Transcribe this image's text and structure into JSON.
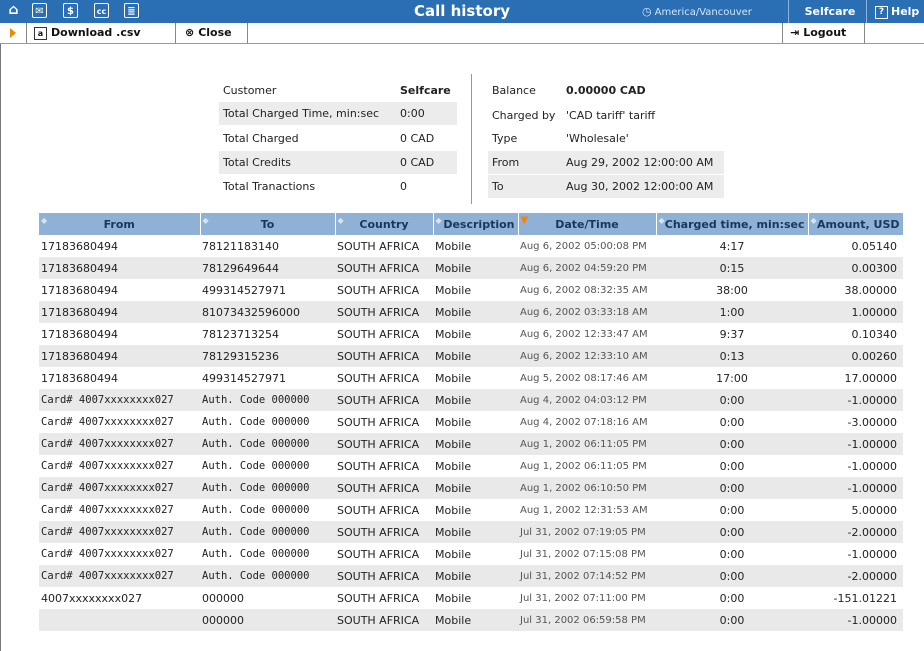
{
  "titlebar": {
    "title": "Call history",
    "timezone": "America/Vancouver",
    "user": "Selfcare",
    "help": "Help",
    "icons": [
      "home-icon",
      "mail-icon",
      "dollar-icon",
      "cc-icon",
      "list-icon"
    ],
    "color": "#2a6eb4"
  },
  "toolbar": {
    "download": "Download .csv",
    "close": "Close",
    "logout": "Logout"
  },
  "summary": {
    "customer_label": "Customer",
    "customer_value": "Selfcare",
    "charged_time_label": "Total Charged Time, min:sec",
    "charged_time_value": "0:00",
    "charged_label": "Total Charged",
    "charged_value": "0 CAD",
    "credits_label": "Total Credits",
    "credits_value": "0 CAD",
    "transactions_label": "Total Tranactions",
    "transactions_value": "0",
    "balance_label": "Balance",
    "balance_value": "0.00000 CAD",
    "charged_by_label": "Charged by",
    "charged_by_value": "'CAD tariff' tariff",
    "type_label": "Type",
    "type_value": "'Wholesale'",
    "from_label": "From",
    "from_value": "Aug 29, 2002 12:00:00 AM",
    "to_label": "To",
    "to_value": "Aug 30, 2002 12:00:00 AM"
  },
  "table": {
    "columns": [
      "From",
      "To",
      "Country",
      "Description",
      "Date/Time",
      "Charged time, min:sec",
      "Amount, USD"
    ],
    "sorted_column": "Date/Time",
    "rows": [
      {
        "from": "17183680494",
        "to": "78121183140",
        "country": "SOUTH AFRICA",
        "desc": "Mobile",
        "date": "Aug 6, 2002 05:00:08 PM",
        "time": "4:17",
        "amount": "0.05140"
      },
      {
        "from": "17183680494",
        "to": "78129649644",
        "country": "SOUTH AFRICA",
        "desc": "Mobile",
        "date": "Aug 6, 2002 04:59:20 PM",
        "time": "0:15",
        "amount": "0.00300"
      },
      {
        "from": "17183680494",
        "to": "499314527971",
        "country": "SOUTH AFRICA",
        "desc": "Mobile",
        "date": "Aug 6, 2002 08:32:35 AM",
        "time": "38:00",
        "amount": "38.00000"
      },
      {
        "from": "17183680494",
        "to": "81073432596000",
        "country": "SOUTH AFRICA",
        "desc": "Mobile",
        "date": "Aug 6, 2002 03:33:18 AM",
        "time": "1:00",
        "amount": "1.00000"
      },
      {
        "from": "17183680494",
        "to": "78123713254",
        "country": "SOUTH AFRICA",
        "desc": "Mobile",
        "date": "Aug 6, 2002 12:33:47 AM",
        "time": "9:37",
        "amount": "0.10340"
      },
      {
        "from": "17183680494",
        "to": "78129315236",
        "country": "SOUTH AFRICA",
        "desc": "Mobile",
        "date": "Aug 6, 2002 12:33:10 AM",
        "time": "0:13",
        "amount": "0.00260"
      },
      {
        "from": "17183680494",
        "to": "499314527971",
        "country": "SOUTH AFRICA",
        "desc": "Mobile",
        "date": "Aug 5, 2002 08:17:46 AM",
        "time": "17:00",
        "amount": "17.00000"
      },
      {
        "from": "Card# 4007xxxxxxxx027",
        "to": "Auth. Code 000000",
        "country": "SOUTH AFRICA",
        "desc": "Mobile",
        "date": "Aug 4, 2002 04:03:12 PM",
        "time": "0:00",
        "amount": "-1.00000",
        "mono": true
      },
      {
        "from": "Card# 4007xxxxxxxx027",
        "to": "Auth. Code 000000",
        "country": "SOUTH AFRICA",
        "desc": "Mobile",
        "date": "Aug 4, 2002 07:18:16 AM",
        "time": "0:00",
        "amount": "-3.00000",
        "mono": true
      },
      {
        "from": "Card# 4007xxxxxxxx027",
        "to": "Auth. Code 000000",
        "country": "SOUTH AFRICA",
        "desc": "Mobile",
        "date": "Aug 1, 2002 06:11:05 PM",
        "time": "0:00",
        "amount": "-1.00000",
        "mono": true
      },
      {
        "from": "Card# 4007xxxxxxxx027",
        "to": "Auth. Code 000000",
        "country": "SOUTH AFRICA",
        "desc": "Mobile",
        "date": "Aug 1, 2002 06:11:05 PM",
        "time": "0:00",
        "amount": "-1.00000",
        "mono": true
      },
      {
        "from": "Card# 4007xxxxxxxx027",
        "to": "Auth. Code 000000",
        "country": "SOUTH AFRICA",
        "desc": "Mobile",
        "date": "Aug 1, 2002 06:10:50 PM",
        "time": "0:00",
        "amount": "-1.00000",
        "mono": true
      },
      {
        "from": "Card# 4007xxxxxxxx027",
        "to": "Auth. Code 000000",
        "country": "SOUTH AFRICA",
        "desc": "Mobile",
        "date": "Aug 1, 2002 12:31:53 AM",
        "time": "0:00",
        "amount": "5.00000",
        "mono": true
      },
      {
        "from": "Card# 4007xxxxxxxx027",
        "to": "Auth. Code 000000",
        "country": "SOUTH AFRICA",
        "desc": "Mobile",
        "date": "Jul 31, 2002 07:19:05 PM",
        "time": "0:00",
        "amount": "-2.00000",
        "mono": true
      },
      {
        "from": "Card# 4007xxxxxxxx027",
        "to": "Auth. Code 000000",
        "country": "SOUTH AFRICA",
        "desc": "Mobile",
        "date": "Jul 31, 2002 07:15:08 PM",
        "time": "0:00",
        "amount": "-1.00000",
        "mono": true
      },
      {
        "from": "Card# 4007xxxxxxxx027",
        "to": "Auth. Code 000000",
        "country": "SOUTH AFRICA",
        "desc": "Mobile",
        "date": "Jul 31, 2002 07:14:52 PM",
        "time": "0:00",
        "amount": "-2.00000",
        "mono": true
      },
      {
        "from": "4007xxxxxxxx027",
        "to": "000000",
        "country": "SOUTH AFRICA",
        "desc": "Mobile",
        "date": "Jul 31, 2002 07:11:00 PM",
        "time": "0:00",
        "amount": "-151.01221"
      },
      {
        "from": "",
        "to": "000000",
        "country": "SOUTH AFRICA",
        "desc": "Mobile",
        "date": "Jul 31, 2002 06:59:58 PM",
        "time": "0:00",
        "amount": "-1.00000"
      }
    ]
  }
}
